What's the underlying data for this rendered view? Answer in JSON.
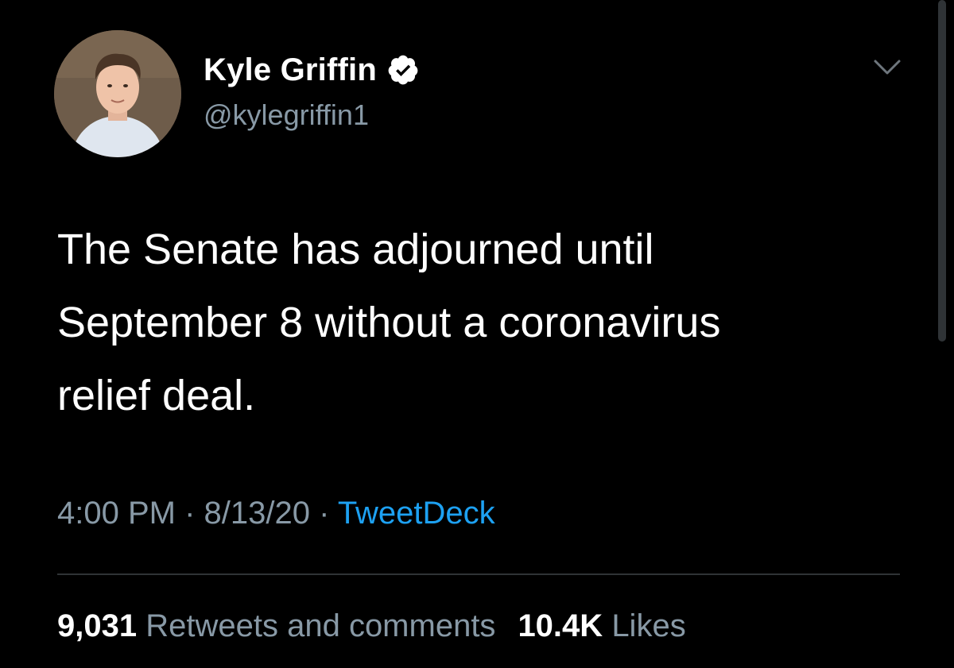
{
  "tweet": {
    "author": {
      "display_name": "Kyle Griffin",
      "handle": "@kylegriffin1",
      "verified": true
    },
    "text_lines": [
      "The Senate has adjourned until",
      "September 8 without a coronavirus",
      "relief deal."
    ],
    "meta": {
      "time": "4:00 PM",
      "separator": " · ",
      "date": "8/13/20",
      "source": "TweetDeck"
    },
    "stats": {
      "retweets_count": "9,031",
      "retweets_label": "Retweets and comments",
      "likes_count": "10.4K",
      "likes_label": "Likes"
    }
  },
  "icons": {
    "verified_badge": "verified-badge-icon",
    "menu_caret": "chevron-down-icon"
  },
  "colors": {
    "background": "#000000",
    "text": "#ffffff",
    "secondary_text": "#8899a6",
    "link": "#1da1f2",
    "divider": "#2f3336"
  }
}
